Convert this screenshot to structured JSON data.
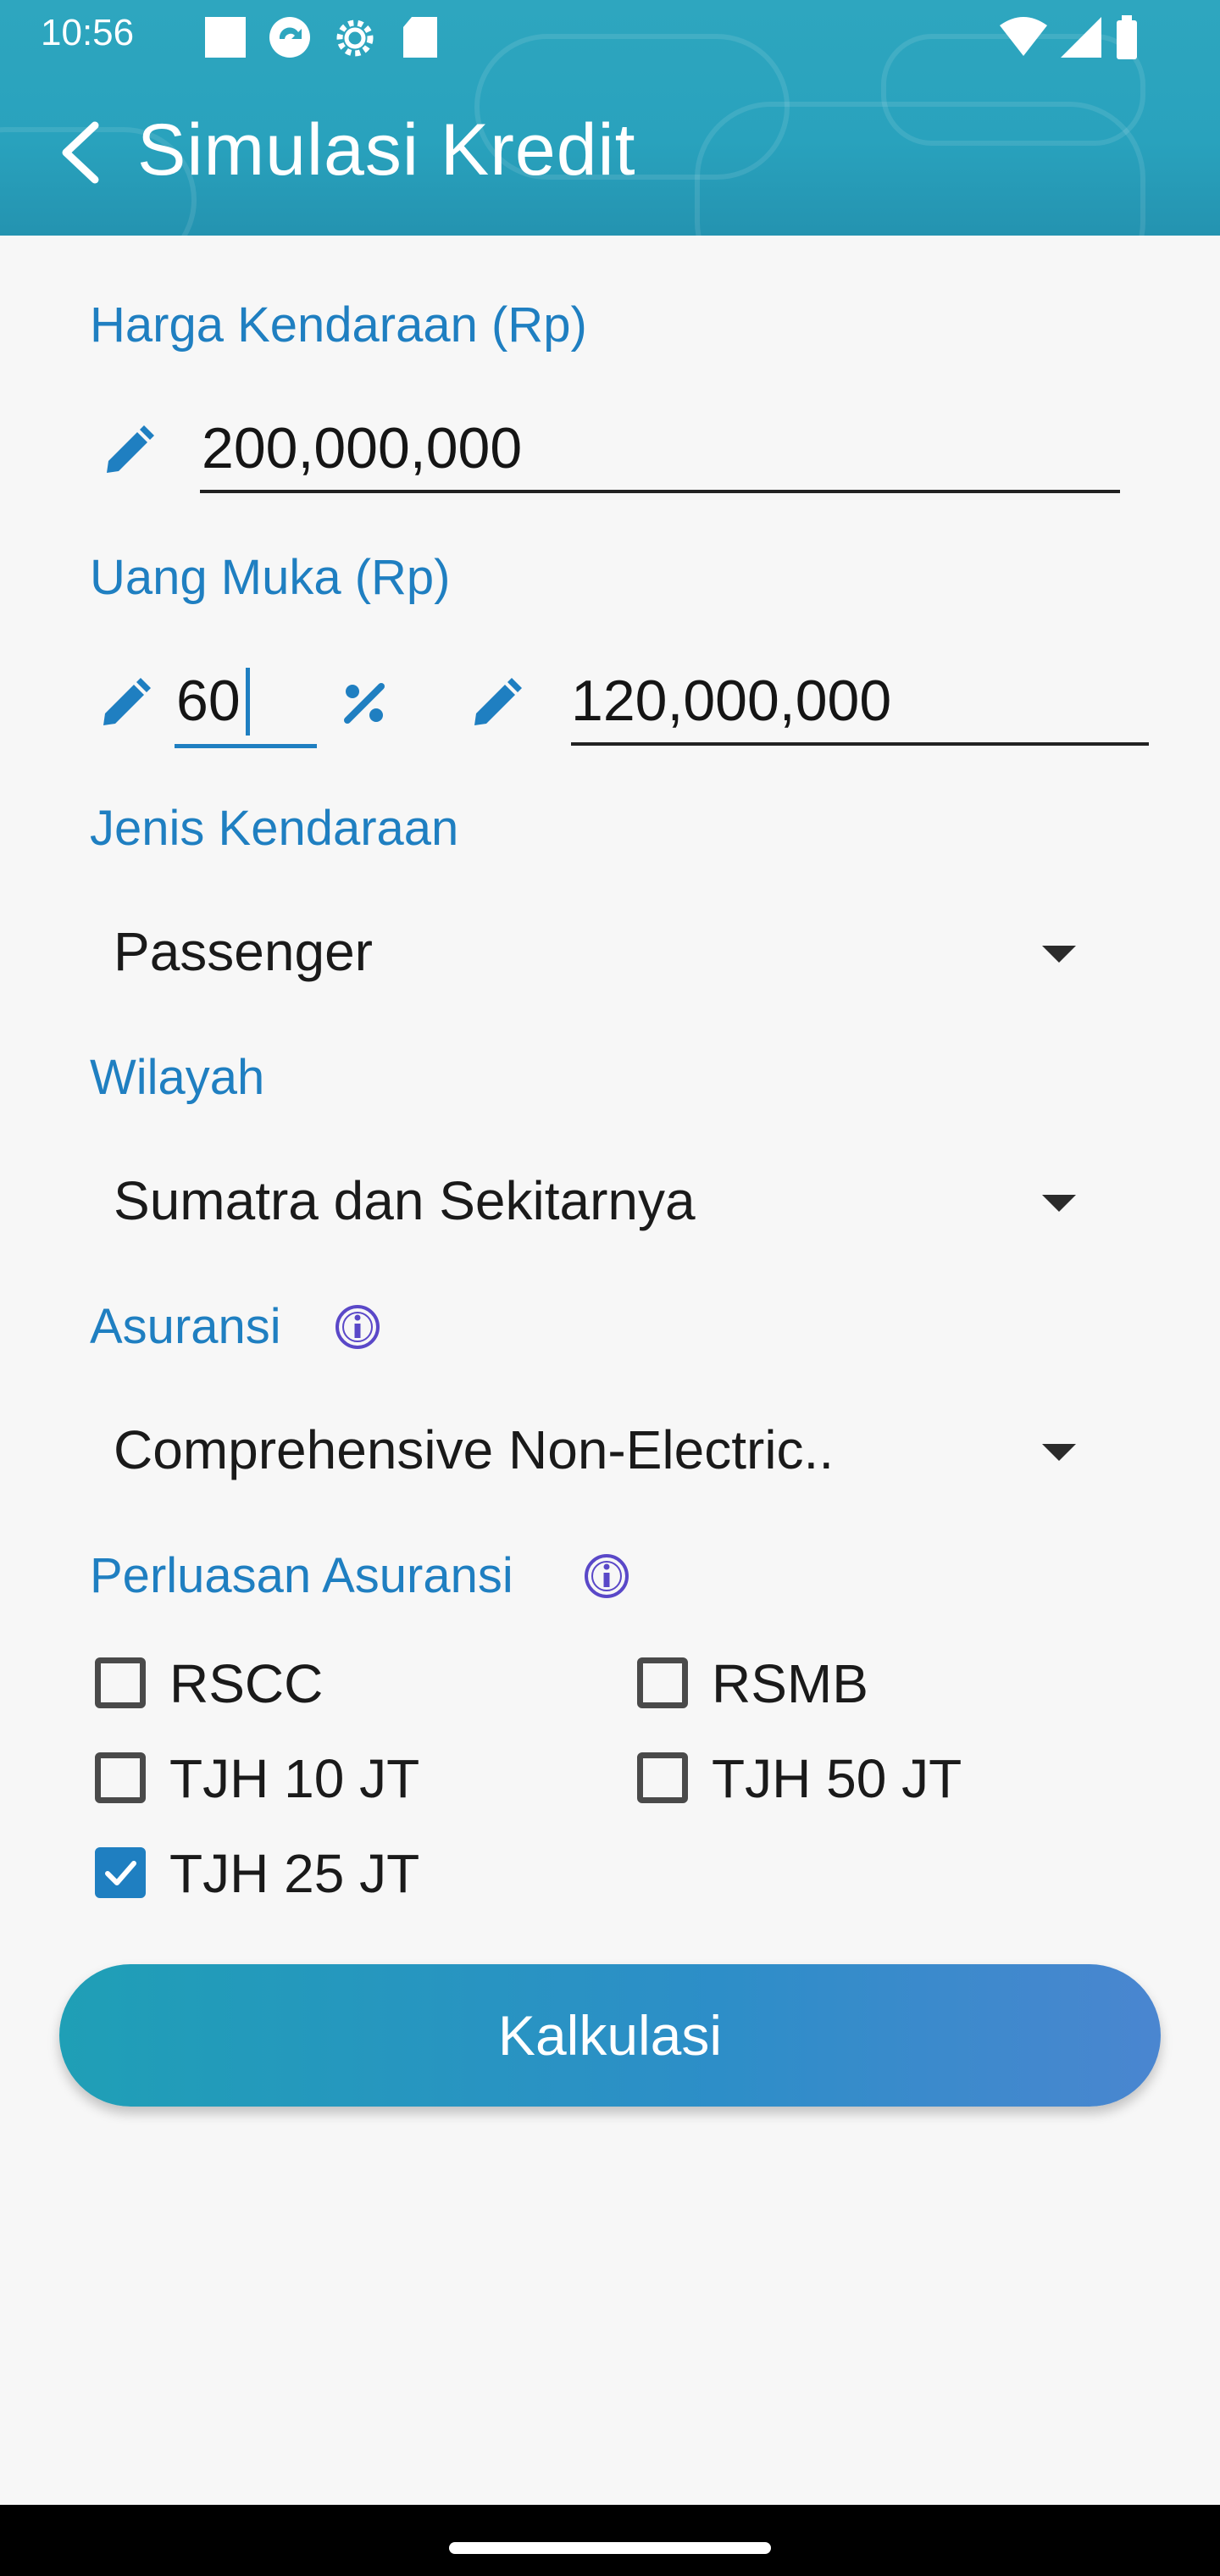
{
  "status_bar": {
    "time": "10:56",
    "icons": [
      "notification-square-icon",
      "sync-icon",
      "settings-icon",
      "sd-card-icon",
      "wifi-icon",
      "signal-icon",
      "battery-icon"
    ]
  },
  "header": {
    "title": "Simulasi Kredit",
    "back_icon": "back-arrow-icon"
  },
  "form": {
    "harga": {
      "label": "Harga Kendaraan (Rp)",
      "value": "200,000,000"
    },
    "uang_muka": {
      "label": "Uang Muka (Rp)",
      "percent_value": "60",
      "amount_value": "120,000,000"
    },
    "jenis": {
      "label": "Jenis Kendaraan",
      "selected": "Passenger"
    },
    "wilayah": {
      "label": "Wilayah",
      "selected": "Sumatra dan Sekitarnya"
    },
    "asuransi": {
      "label": "Asuransi",
      "selected": "Comprehensive Non-Electric.."
    },
    "perluasan": {
      "label": "Perluasan Asuransi",
      "options": [
        {
          "label": "RSCC",
          "checked": false
        },
        {
          "label": "RSMB",
          "checked": false
        },
        {
          "label": "TJH 10 JT",
          "checked": false
        },
        {
          "label": "TJH 50 JT",
          "checked": false
        },
        {
          "label": "TJH 25 JT",
          "checked": true
        }
      ]
    }
  },
  "actions": {
    "calculate_label": "Kalkulasi"
  },
  "colors": {
    "accent": "#1f7fc1",
    "header": "#29a2bd",
    "button_start": "#1f9fb6",
    "button_end": "#4a86d0"
  }
}
